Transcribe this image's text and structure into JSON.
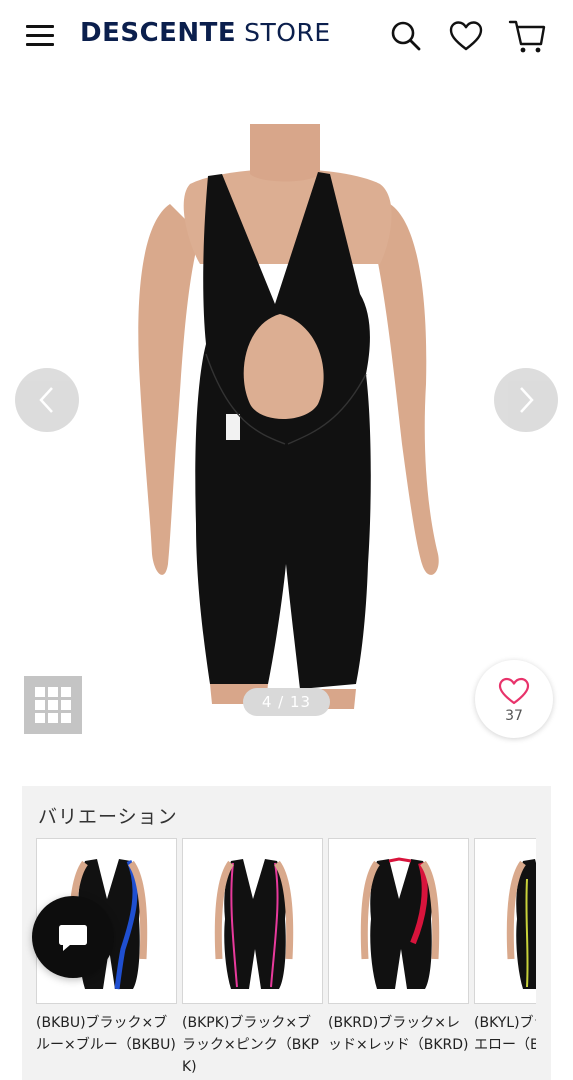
{
  "header": {
    "brand": "DESCENTE",
    "store": "STORE",
    "icons": [
      "menu-icon",
      "search-icon",
      "heart-icon",
      "cart-icon"
    ]
  },
  "gallery": {
    "counter": "4 / 13",
    "favorite_count": "37",
    "icons": [
      "chevron-left-icon",
      "chevron-right-icon",
      "grid-icon",
      "heart-outline-icon"
    ],
    "accent_color": "#e8336b"
  },
  "variation": {
    "title": "バリエーション",
    "items": [
      {
        "label": "(BKBU)ブラック×ブルー×ブルー（BKBU)",
        "accent": "#1f4fd1"
      },
      {
        "label": "(BKPK)ブラック×ブラック×ピンク（BKPK)",
        "accent": "#e83a9c"
      },
      {
        "label": "(BKRD)ブラック×レッド×レッド（BKRD)",
        "accent": "#d8143c"
      },
      {
        "label": "(BKYL)ブラック×イエロー（BKYL)",
        "accent": "#c8d23a"
      }
    ]
  },
  "chat": {
    "icon": "chat-bubble-icon"
  }
}
